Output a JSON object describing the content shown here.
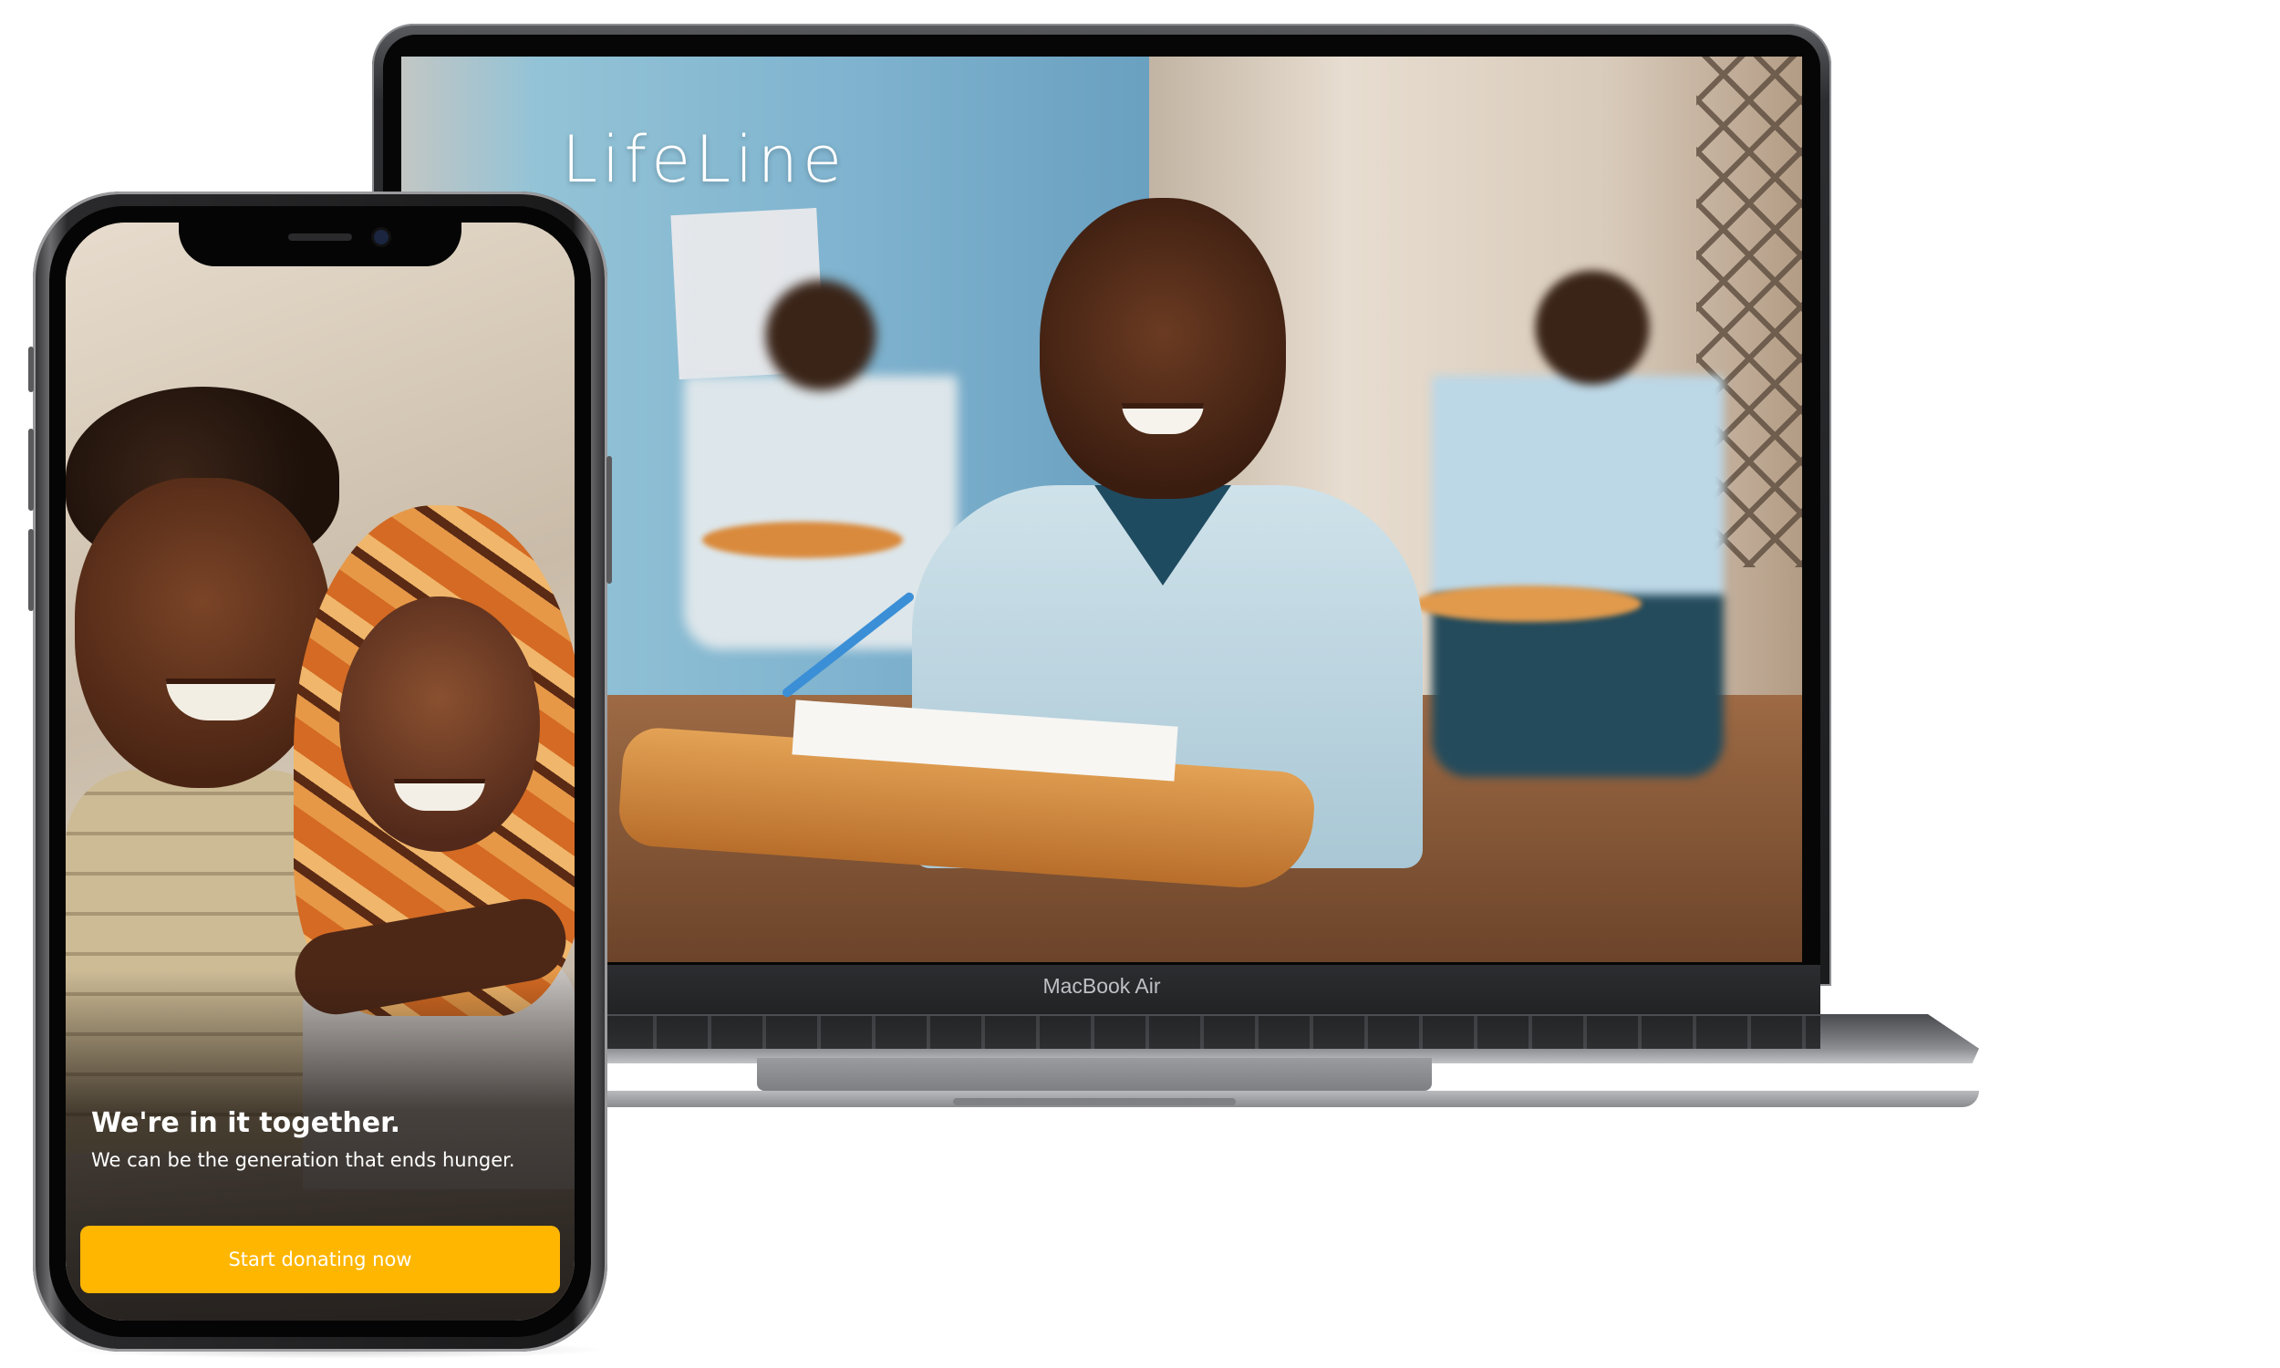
{
  "laptop": {
    "brand": "LifeLine",
    "model_label": "MacBook Air"
  },
  "phone": {
    "headline": "We're in it together.",
    "subtext": "We can be the generation that ends hunger.",
    "cta_label": "Start donating now"
  },
  "colors": {
    "cta_background": "#ffb600",
    "cta_text": "#ffffff",
    "brand_text": "#ffffff"
  }
}
